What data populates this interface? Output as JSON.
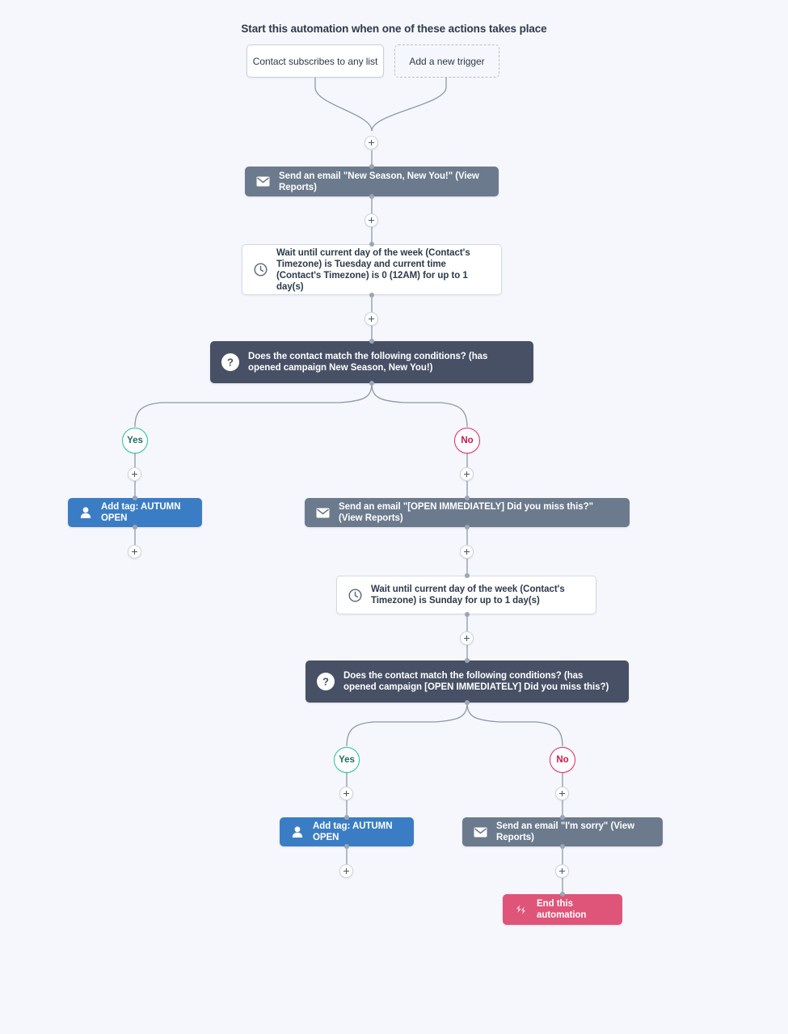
{
  "header": {
    "title": "Start this automation when one of these actions takes place"
  },
  "nodes": {
    "trigger_subscribe": {
      "label": "Contact subscribes to any list"
    },
    "trigger_add": {
      "label": "Add a new trigger"
    },
    "email_1": {
      "label": "Send an email \"New Season, New You!\" (View Reports)",
      "icon": "envelope-icon"
    },
    "wait_1": {
      "label": "Wait until current day of the week (Contact's Timezone) is Tuesday and current time (Contact's Timezone) is 0 (12AM) for up to 1 day(s)",
      "icon": "clock-icon"
    },
    "cond_1": {
      "label": "Does the contact match the following conditions? (has opened campaign New Season, New You!)",
      "icon": "question-icon"
    },
    "branch_1_yes": {
      "label": "Yes"
    },
    "branch_1_no": {
      "label": "No"
    },
    "tag_1": {
      "label": "Add tag: AUTUMN OPEN",
      "icon": "person-icon"
    },
    "email_2": {
      "label": "Send an email \"[OPEN IMMEDIATELY] Did you miss this?\" (View Reports)",
      "icon": "envelope-icon"
    },
    "wait_2": {
      "label": "Wait until current day of the week (Contact's Timezone) is Sunday for up to 1 day(s)",
      "icon": "clock-icon"
    },
    "cond_2": {
      "label": "Does the contact match the following conditions? (has opened campaign [OPEN IMMEDIATELY] Did you miss this?)",
      "icon": "question-icon"
    },
    "branch_2_yes": {
      "label": "Yes"
    },
    "branch_2_no": {
      "label": "No"
    },
    "tag_2": {
      "label": "Add tag: AUTUMN OPEN",
      "icon": "person-icon"
    },
    "email_3": {
      "label": "Send an email \"I'm sorry\" (View Reports)",
      "icon": "envelope-icon"
    },
    "end_1": {
      "label": "End this automation",
      "icon": "end-automation-icon"
    }
  },
  "colors": {
    "background": "#f6f7fc",
    "email_node": "#6c7a8d",
    "condition_node": "#475065",
    "tag_node": "#3b7dc4",
    "end_node": "#de5579",
    "yes_accent": "#23c4a0",
    "no_accent": "#f0245c",
    "connector": "#8d98a9"
  }
}
